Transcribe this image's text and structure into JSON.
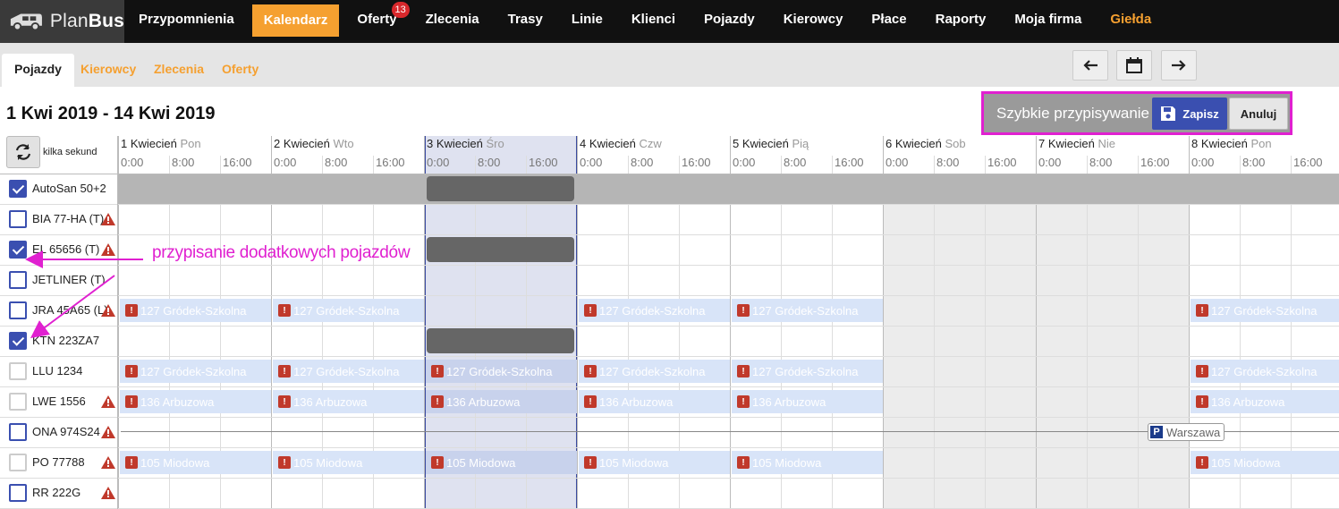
{
  "app": {
    "logo_light": "Plan",
    "logo_bold": "Bus"
  },
  "nav": [
    {
      "label": "Przypomnienia"
    },
    {
      "label": "Kalendarz",
      "active": true
    },
    {
      "label": "Oferty",
      "badge": "13"
    },
    {
      "label": "Zlecenia"
    },
    {
      "label": "Trasy"
    },
    {
      "label": "Linie"
    },
    {
      "label": "Klienci"
    },
    {
      "label": "Pojazdy"
    },
    {
      "label": "Kierowcy"
    },
    {
      "label": "Płace"
    },
    {
      "label": "Raporty"
    },
    {
      "label": "Moja firma"
    },
    {
      "label": "Giełda",
      "highlight": true
    }
  ],
  "subtabs": [
    "Pojazdy",
    "Kierowcy",
    "Zlecenia",
    "Oferty"
  ],
  "range_title": "1 Kwi 2019 - 14 Kwi 2019",
  "quick_assign": {
    "label": "Szybkie przypisywanie",
    "save": "Zapisz",
    "cancel": "Anuluj"
  },
  "refresh": {
    "label": "kilka sekund"
  },
  "days": [
    {
      "name": "1 Kwiecień",
      "wd": "Pon"
    },
    {
      "name": "2 Kwiecień",
      "wd": "Wto"
    },
    {
      "name": "3 Kwiecień",
      "wd": "Śro"
    },
    {
      "name": "4 Kwiecień",
      "wd": "Czw"
    },
    {
      "name": "5 Kwiecień",
      "wd": "Pią"
    },
    {
      "name": "6 Kwiecień",
      "wd": "Sob"
    },
    {
      "name": "7 Kwiecień",
      "wd": "Nie"
    },
    {
      "name": "8 Kwiecień",
      "wd": "Pon"
    }
  ],
  "hours": [
    "0:00",
    "8:00",
    "16:00"
  ],
  "vehicles": [
    {
      "name": "AutoSan 50+2",
      "checked": true,
      "warn": false
    },
    {
      "name": "BIA 77-HA (T)",
      "checked": false,
      "warn": true
    },
    {
      "name": "EL 65656 (T)",
      "checked": true,
      "warn": true
    },
    {
      "name": "JETLINER (T)",
      "checked": false,
      "warn": false
    },
    {
      "name": "JRA 45A65 (L)",
      "checked": false,
      "warn": true
    },
    {
      "name": "KTN 223ZA7",
      "checked": true,
      "warn": false
    },
    {
      "name": "LLU 1234",
      "checked": false,
      "warn": false,
      "light": true
    },
    {
      "name": "LWE 1556",
      "checked": false,
      "warn": true,
      "light": true
    },
    {
      "name": "ONA 974S24",
      "checked": false,
      "warn": true
    },
    {
      "name": "PO 77788",
      "checked": false,
      "warn": true,
      "light": true
    },
    {
      "name": "RR 222G",
      "checked": false,
      "warn": true
    }
  ],
  "trips": {
    "grodek": "127 Gródek-Szkolna",
    "arbuzowa": "136 Arbuzowa",
    "miodowa": "105 Miodowa"
  },
  "parking": {
    "label": "Warszawa"
  },
  "annotation": "przypisanie dodatkowych pojazdów"
}
